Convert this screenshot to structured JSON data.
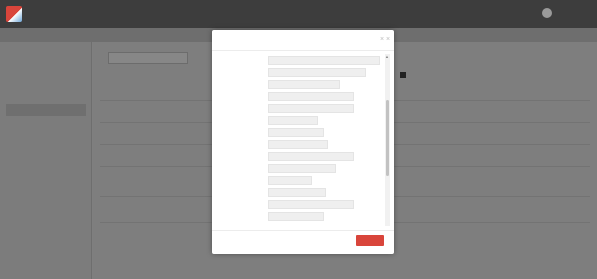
{
  "topbar": {
    "brand": "",
    "nav": [
      "",
      "",
      "",
      ""
    ],
    "right": [
      "",
      ""
    ]
  },
  "breadcrumb": "",
  "sidebar": {
    "items": [
      "",
      "",
      "",
      "",
      "",
      ""
    ]
  },
  "main": {
    "filter_label": "",
    "row_count": "",
    "columns": [
      "",
      "",
      "",
      "",
      ""
    ],
    "rows": [
      {
        "c1": "",
        "c2": "",
        "c3": "",
        "c4": "",
        "c5": ""
      },
      {
        "c1": "",
        "c2": "",
        "c3": "",
        "c4": "",
        "c5": ""
      },
      {
        "c1": "",
        "c2": "",
        "c3": "",
        "c4": "",
        "c5": ""
      },
      {
        "c1": "",
        "c2": "",
        "c3": "",
        "c4": "",
        "c5": ""
      },
      {
        "c1": "",
        "c2": "",
        "c3": "",
        "c4": "",
        "c5": ""
      },
      {
        "c1": "",
        "c2": "",
        "c3": "",
        "c4": "",
        "c5": ""
      }
    ],
    "footer": ""
  },
  "modal": {
    "title": "",
    "options": [
      "",
      "",
      "",
      "",
      "",
      "",
      "",
      "",
      "",
      "",
      "",
      "",
      "",
      ""
    ],
    "cancel_label": "",
    "ok_label": ""
  },
  "colors": {
    "accent": "#d9453b",
    "topbar": "#3d3d3d",
    "link": "#a9c5e6"
  }
}
